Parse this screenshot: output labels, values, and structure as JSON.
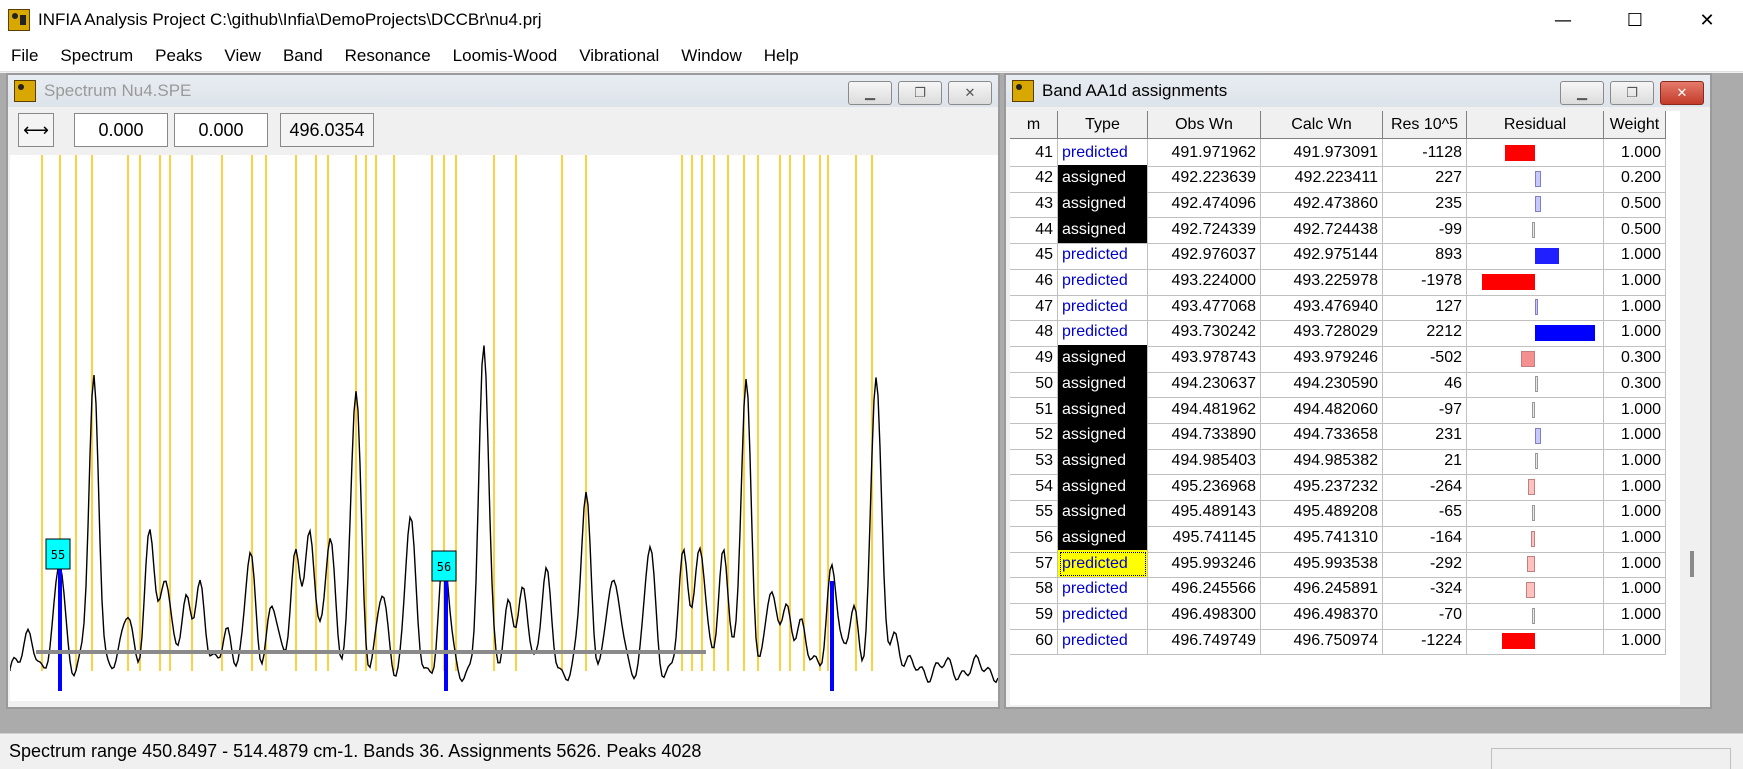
{
  "app": {
    "title": "INFIA Analysis Project C:\\github\\Infia\\DemoProjects\\DCCBr\\nu4.prj",
    "minimize": "—",
    "maximize": "☐",
    "close": "✕"
  },
  "menu": [
    "File",
    "Spectrum",
    "Peaks",
    "View",
    "Band",
    "Resonance",
    "Loomis-Wood",
    "Vibrational",
    "Window",
    "Help"
  ],
  "spectrum_window": {
    "title": "Spectrum Nu4.SPE",
    "field1": "0.000",
    "field2": "0.000",
    "field3": "496.0354",
    "markers": [
      "55",
      "56"
    ],
    "colors": {
      "prediction_line": "#ffc000",
      "assigned_peak": "#0000ff",
      "trace": "#000000",
      "marker_bg": "#00ffff"
    }
  },
  "band_window": {
    "title": "Band AA1d assignments",
    "headers": [
      "m",
      "Type",
      "Obs Wn",
      "Calc Wn",
      "Res 10^5",
      "Residual",
      "Weight"
    ],
    "rows": [
      {
        "m": "41",
        "type": "predicted",
        "obs": "491.971962",
        "calc": "491.973091",
        "res": "-1128",
        "weight": "1.000"
      },
      {
        "m": "42",
        "type": "assigned",
        "obs": "492.223639",
        "calc": "492.223411",
        "res": "227",
        "weight": "0.200"
      },
      {
        "m": "43",
        "type": "assigned",
        "obs": "492.474096",
        "calc": "492.473860",
        "res": "235",
        "weight": "0.500"
      },
      {
        "m": "44",
        "type": "assigned",
        "obs": "492.724339",
        "calc": "492.724438",
        "res": "-99",
        "weight": "0.500"
      },
      {
        "m": "45",
        "type": "predicted",
        "obs": "492.976037",
        "calc": "492.975144",
        "res": "893",
        "weight": "1.000"
      },
      {
        "m": "46",
        "type": "predicted",
        "obs": "493.224000",
        "calc": "493.225978",
        "res": "-1978",
        "weight": "1.000"
      },
      {
        "m": "47",
        "type": "predicted",
        "obs": "493.477068",
        "calc": "493.476940",
        "res": "127",
        "weight": "1.000"
      },
      {
        "m": "48",
        "type": "predicted",
        "obs": "493.730242",
        "calc": "493.728029",
        "res": "2212",
        "weight": "1.000"
      },
      {
        "m": "49",
        "type": "assigned",
        "obs": "493.978743",
        "calc": "493.979246",
        "res": "-502",
        "weight": "0.300"
      },
      {
        "m": "50",
        "type": "assigned",
        "obs": "494.230637",
        "calc": "494.230590",
        "res": "46",
        "weight": "0.300"
      },
      {
        "m": "51",
        "type": "assigned",
        "obs": "494.481962",
        "calc": "494.482060",
        "res": "-97",
        "weight": "1.000"
      },
      {
        "m": "52",
        "type": "assigned",
        "obs": "494.733890",
        "calc": "494.733658",
        "res": "231",
        "weight": "1.000"
      },
      {
        "m": "53",
        "type": "assigned",
        "obs": "494.985403",
        "calc": "494.985382",
        "res": "21",
        "weight": "1.000"
      },
      {
        "m": "54",
        "type": "assigned",
        "obs": "495.236968",
        "calc": "495.237232",
        "res": "-264",
        "weight": "1.000"
      },
      {
        "m": "55",
        "type": "assigned",
        "obs": "495.489143",
        "calc": "495.489208",
        "res": "-65",
        "weight": "1.000"
      },
      {
        "m": "56",
        "type": "assigned",
        "obs": "495.741145",
        "calc": "495.741310",
        "res": "-164",
        "weight": "1.000"
      },
      {
        "m": "57",
        "type": "predicted",
        "obs": "495.993246",
        "calc": "495.993538",
        "res": "-292",
        "weight": "1.000",
        "selected": true
      },
      {
        "m": "58",
        "type": "predicted",
        "obs": "496.245566",
        "calc": "496.245891",
        "res": "-324",
        "weight": "1.000"
      },
      {
        "m": "59",
        "type": "predicted",
        "obs": "496.498300",
        "calc": "496.498370",
        "res": "-70",
        "weight": "1.000"
      },
      {
        "m": "60",
        "type": "predicted",
        "obs": "496.749749",
        "calc": "496.750974",
        "res": "-1224",
        "weight": "1.000"
      }
    ]
  },
  "status": {
    "text": "Spectrum range 450.8497 - 514.4879 cm-1. Bands 36. Assignments 5626. Peaks 4028"
  }
}
